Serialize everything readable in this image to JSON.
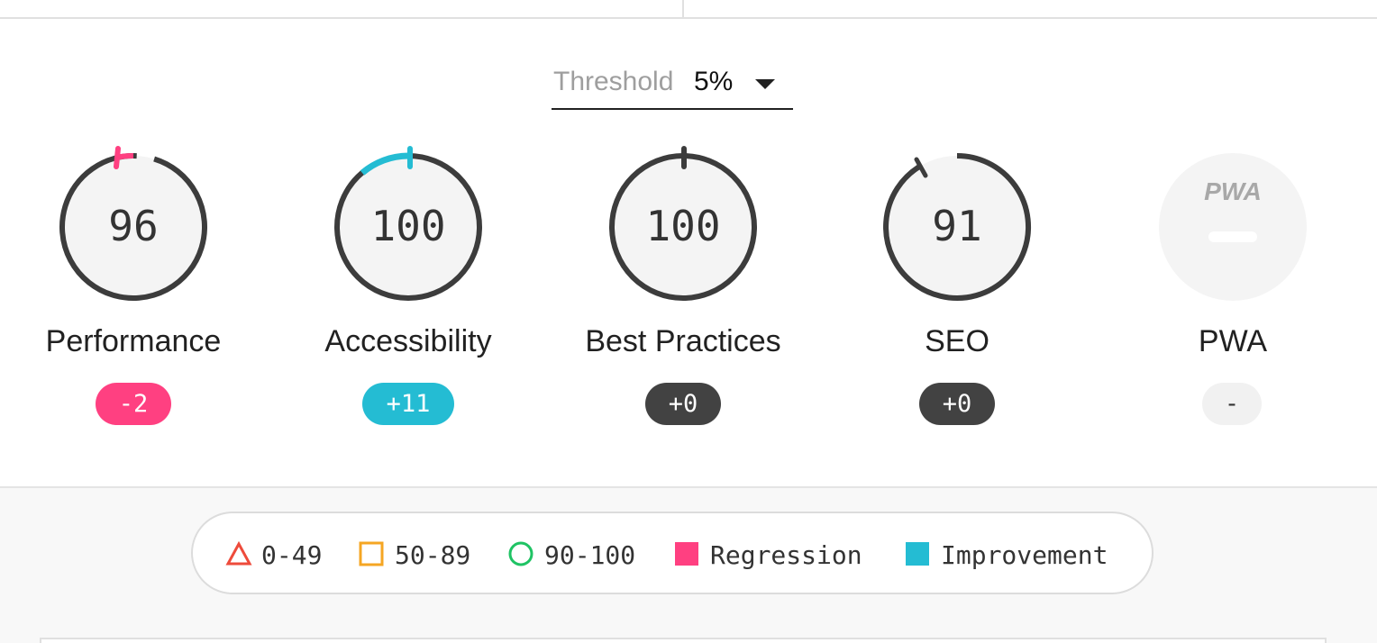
{
  "threshold": {
    "label": "Threshold",
    "value": "5%"
  },
  "gauges": [
    {
      "name": "Performance",
      "score": "96",
      "delta": "-2",
      "delta_type": "regression"
    },
    {
      "name": "Accessibility",
      "score": "100",
      "delta": "+11",
      "delta_type": "improvement"
    },
    {
      "name": "Best Practices",
      "score": "100",
      "delta": "+0",
      "delta_type": "neutral"
    },
    {
      "name": "SEO",
      "score": "91",
      "delta": "+0",
      "delta_type": "neutral"
    },
    {
      "name": "PWA",
      "score": "",
      "delta": "-",
      "delta_type": "none",
      "logo": "PWA"
    }
  ],
  "legend": [
    {
      "icon": "triangle-icon",
      "label": "0-49",
      "color": "#ee4b3b"
    },
    {
      "icon": "square-outline-icon",
      "label": "50-89",
      "color": "#f5a623"
    },
    {
      "icon": "circle-outline-icon",
      "label": "90-100",
      "color": "#1fc364"
    },
    {
      "icon": "square-filled-icon",
      "label": "Regression",
      "color": "#ff4081"
    },
    {
      "icon": "square-filled-icon",
      "label": "Improvement",
      "color": "#24bcd3"
    }
  ],
  "colors": {
    "regression": "#ff4081",
    "improvement": "#24bcd3",
    "neutral": "#424242",
    "ring": "#3c3c3c",
    "ring_fill": "#f4f4f4"
  }
}
